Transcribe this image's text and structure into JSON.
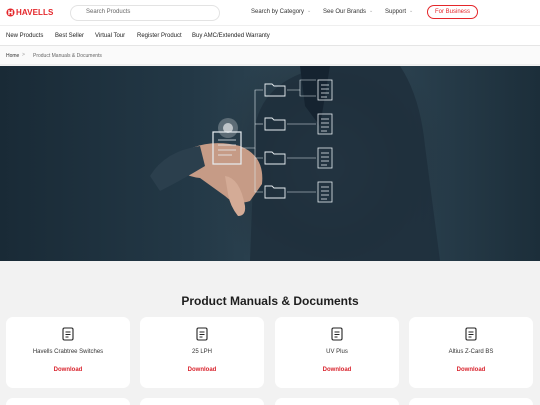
{
  "brand": {
    "name": "HAVELLS",
    "color": "#e4262a"
  },
  "header": {
    "search_placeholder": "Search Products",
    "nav": [
      "Search by Category",
      "See Our Brands",
      "Support"
    ],
    "business_button": "For Business"
  },
  "menu": [
    "New Products",
    "Best Seller",
    "Virtual Tour",
    "Register Product",
    "Buy AMC/Extended Warranty"
  ],
  "breadcrumb": {
    "home": "Home",
    "separator": ">",
    "current": "Product Manuals & Documents"
  },
  "hero": {
    "image": "hand touching virtual document with folder network"
  },
  "section": {
    "title": "Product Manuals & Documents"
  },
  "cards": [
    {
      "name": "Havells Crabtree Switches",
      "action": "Download",
      "icon": "document-icon"
    },
    {
      "name": "25 LPH",
      "action": "Download",
      "icon": "document-icon"
    },
    {
      "name": "UV Plus",
      "action": "Download",
      "icon": "document-icon"
    },
    {
      "name": "Altius Z-Card BS",
      "action": "Download",
      "icon": "document-icon"
    }
  ],
  "colors": {
    "accent": "#d9232d",
    "page_bg": "#f2f2f2"
  }
}
